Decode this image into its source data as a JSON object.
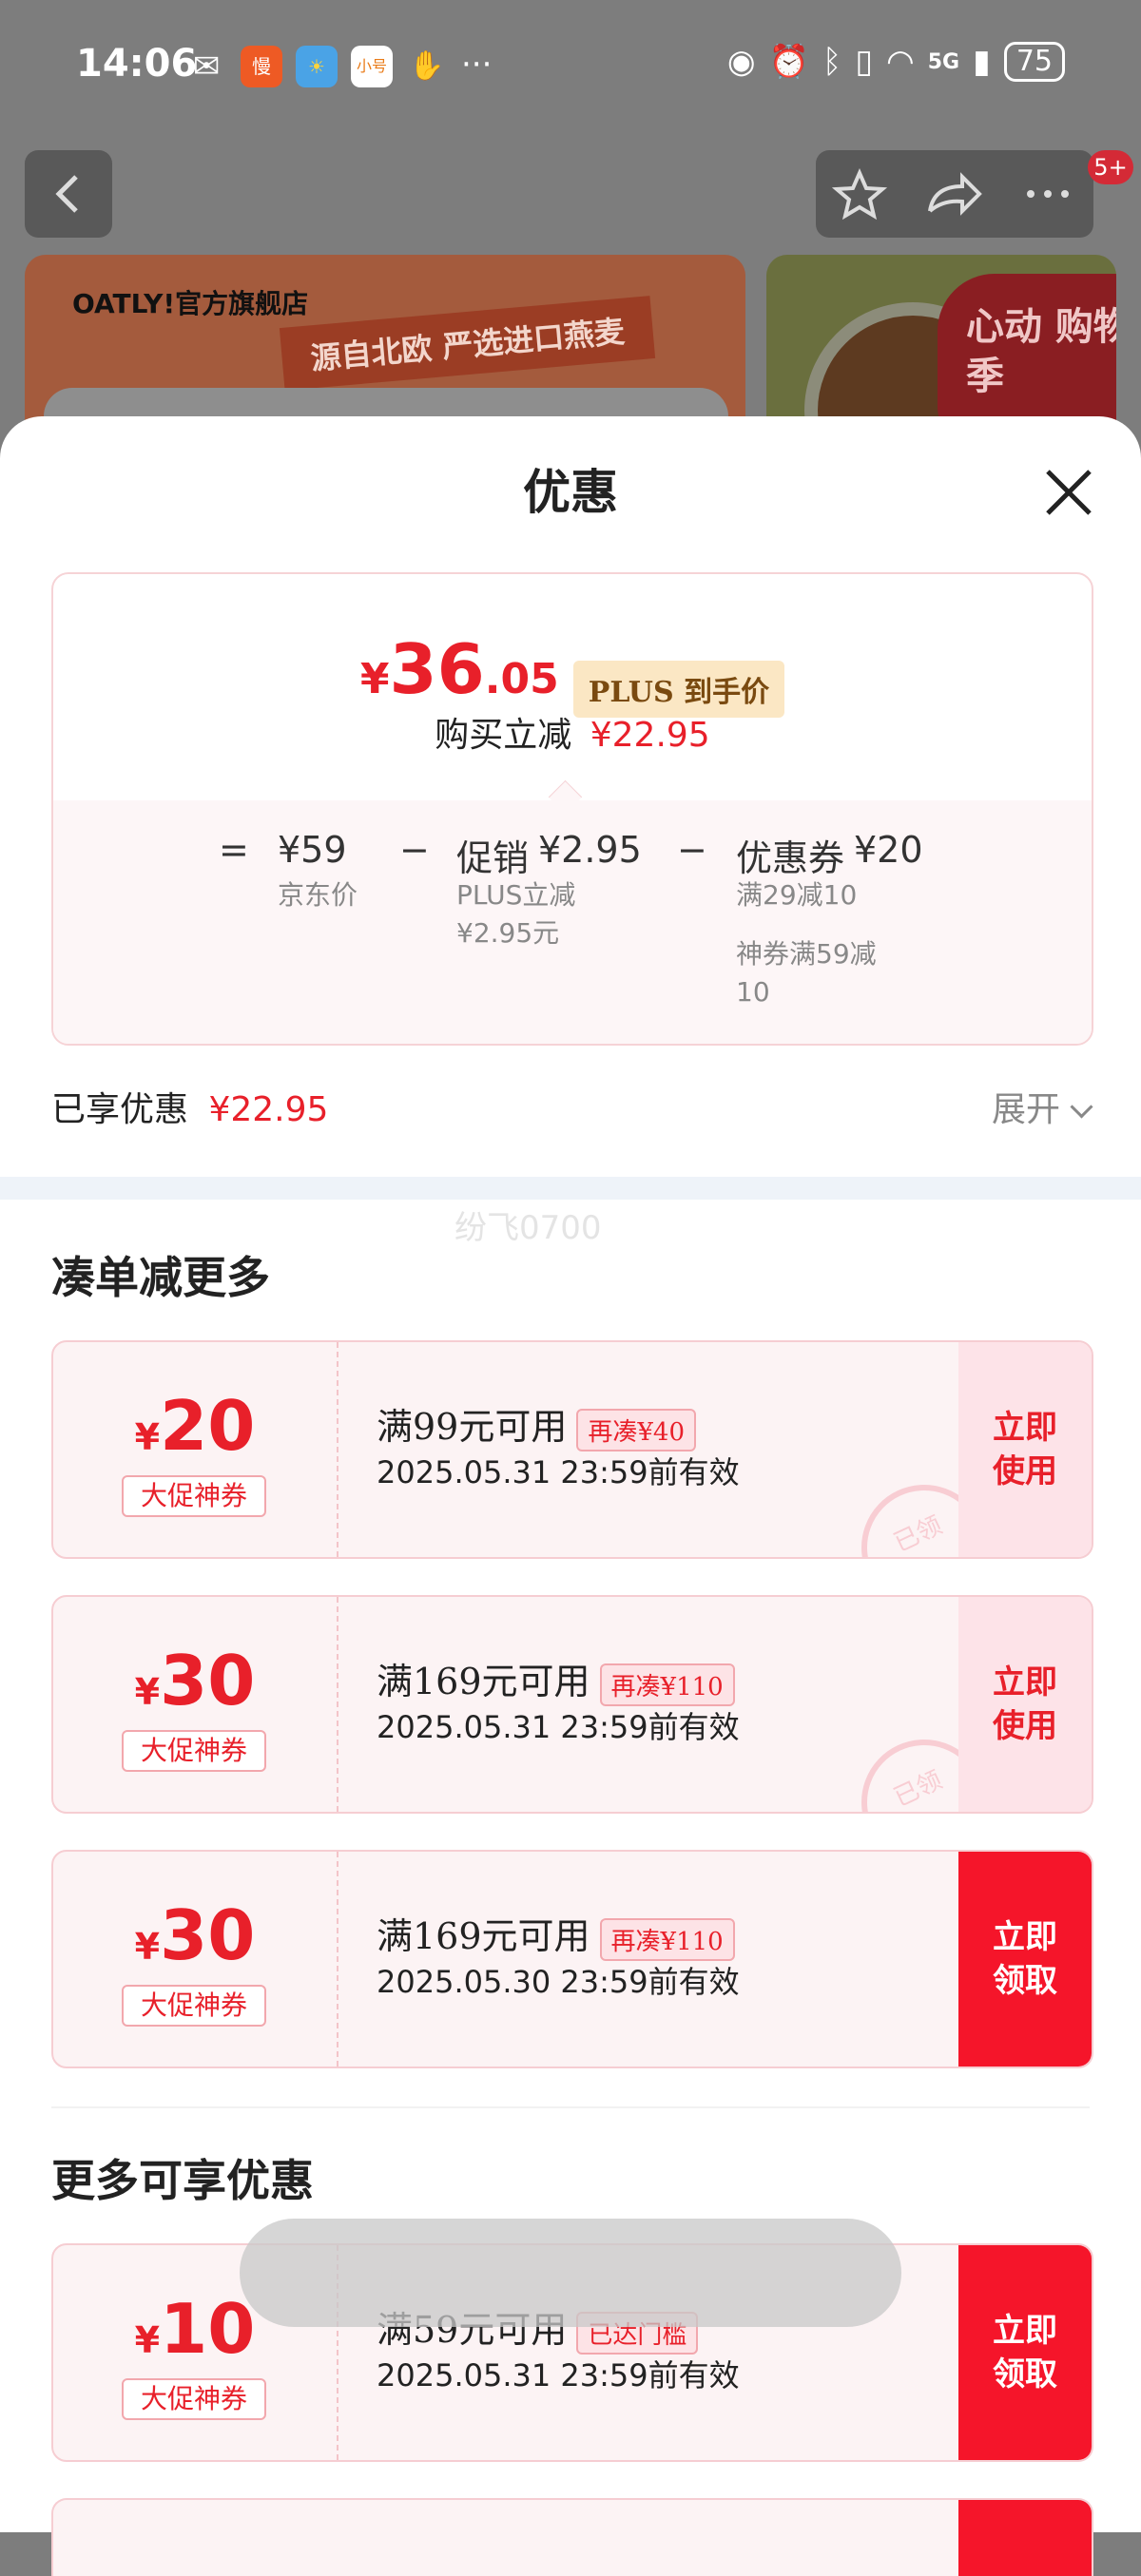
{
  "status_bar": {
    "time": "14:06",
    "network": "5G",
    "battery": "75",
    "app_icons": [
      "wechat-icon",
      "man-icon",
      "weather-icon",
      "xiaohao-icon",
      "hand-icon"
    ],
    "more": "···"
  },
  "background": {
    "banner_store": "OATLY!官方旗舰店",
    "banner_slogan": "源自北欧 严选进口燕麦",
    "badge_count": "5+",
    "promo_tag": "心动 购物季"
  },
  "sheet": {
    "title": "优惠"
  },
  "price_card": {
    "currency": "¥",
    "price_int": "36",
    "price_dec": ".05",
    "plus_label": "PLUS 到手价",
    "discount_label": "购买立减",
    "discount_value": "¥22.95",
    "eq": "=",
    "minus": "−",
    "jd_price": "¥59",
    "jd_price_label": "京东价",
    "promo_label": "促销",
    "promo_value": "¥2.95",
    "promo_detail_1": "PLUS立减",
    "promo_detail_2": "¥2.95元",
    "coupon_label": "优惠券",
    "coupon_value": "¥20",
    "coupon_detail_1": "满29减10",
    "coupon_detail_2": "神券满59减",
    "coupon_detail_3": "10"
  },
  "enjoyed": {
    "label": "已享优惠",
    "value": "¥22.95",
    "expand": "展开"
  },
  "watermark": "纷飞0700",
  "section1": {
    "title": "凑单减更多",
    "coupons": [
      {
        "yen": "¥",
        "amount": "20",
        "type": "大促神券",
        "condition": "满99元可用",
        "tag": "再凑¥40",
        "date": "2025.05.31 23:59前有效",
        "button_line1": "立即",
        "button_line2": "使用",
        "stamp": "已领"
      },
      {
        "yen": "¥",
        "amount": "30",
        "type": "大促神券",
        "condition": "满169元可用",
        "tag": "再凑¥110",
        "date": "2025.05.31 23:59前有效",
        "button_line1": "立即",
        "button_line2": "使用",
        "stamp": "已领"
      },
      {
        "yen": "¥",
        "amount": "30",
        "type": "大促神券",
        "condition": "满169元可用",
        "tag": "再凑¥110",
        "date": "2025.05.30 23:59前有效",
        "button_line1": "立即",
        "button_line2": "领取"
      }
    ]
  },
  "section2": {
    "title": "更多可享优惠",
    "coupons": [
      {
        "yen": "¥",
        "amount": "10",
        "type": "大促神券",
        "condition": "满59元可用",
        "tag": "已达门槛",
        "date": "2025.05.31 23:59前有效",
        "button_line1": "立即",
        "button_line2": "领取"
      }
    ]
  },
  "colors": {
    "accent_red": "#e8202a",
    "button_red": "#f5152a",
    "coupon_bg": "#fcf3f4",
    "plus_bg": "#fbe7c4"
  }
}
